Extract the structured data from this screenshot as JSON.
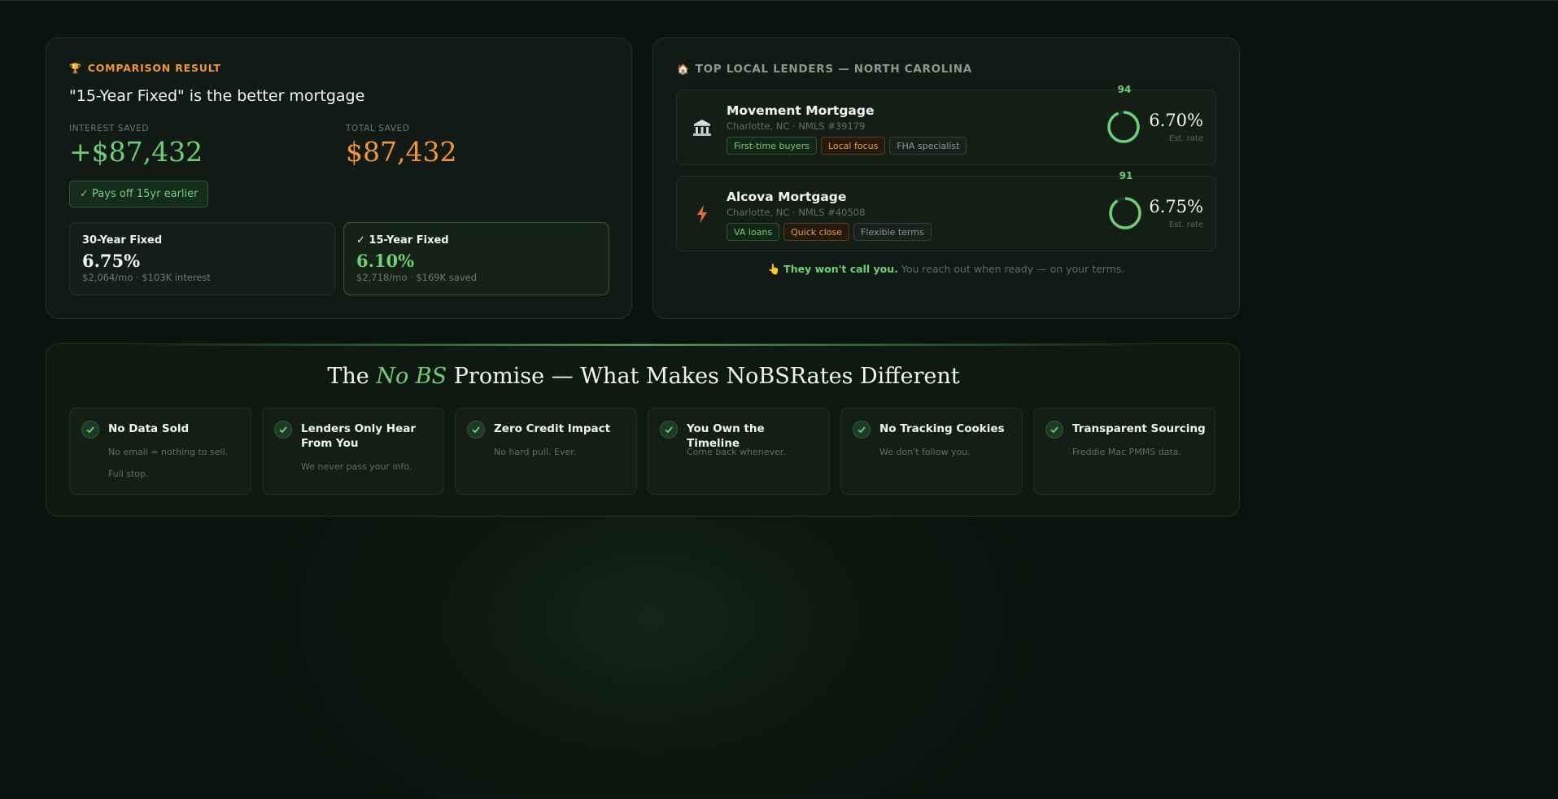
{
  "comparison": {
    "header": "COMPARISON RESULT",
    "title": "\"15-Year Fixed\" is the better mortgage",
    "interest_saved_label": "INTEREST SAVED",
    "interest_saved_value": "+$87,432",
    "total_saved_label": "TOTAL SAVED",
    "total_saved_value": "$87,432",
    "payoff_badge": "✓ Pays off 15yr earlier",
    "options": [
      {
        "name": "30-Year Fixed",
        "rate": "6.75%",
        "detail": "$2,064/mo · $103K interest"
      },
      {
        "name": "✓ 15-Year Fixed",
        "rate": "6.10%",
        "detail": "$2,718/mo · $169K saved"
      }
    ]
  },
  "lenders": {
    "header": "TOP LOCAL LENDERS — NORTH CAROLINA",
    "items": [
      {
        "name": "Movement Mortgage",
        "location": "Charlotte, NC · NMLS #39179",
        "tags": [
          "First-time buyers",
          "Local focus",
          "FHA specialist"
        ],
        "score": "94",
        "rate": "6.70%",
        "rate_label": "Est. rate",
        "icon": "bank-icon"
      },
      {
        "name": "Alcova Mortgage",
        "location": "Charlotte, NC · NMLS #40508",
        "tags": [
          "VA loans",
          "Quick close",
          "Flexible terms"
        ],
        "score": "91",
        "rate": "6.75%",
        "rate_label": "Est. rate",
        "icon": "lightning-icon"
      }
    ],
    "no_call_bold": "They won't call you.",
    "no_call_rest": " You reach out when ready — on your terms.",
    "colors": {
      "accent_green": "#6fcf76",
      "accent_orange": "#f0963a"
    }
  },
  "promise": {
    "title_pre": "The ",
    "title_em": "No BS",
    "title_post": " Promise — What Makes NoBSRates Different",
    "features": [
      {
        "title": "No Data Sold",
        "desc": "No email = nothing to sell. Full stop."
      },
      {
        "title": "Lenders Only Hear From You",
        "desc": "We never pass your info."
      },
      {
        "title": "Zero Credit Impact",
        "desc": "No hard pull. Ever."
      },
      {
        "title": "You Own the Timeline",
        "desc": "Come back whenever."
      },
      {
        "title": "No Tracking Cookies",
        "desc": "We don't follow you."
      },
      {
        "title": "Transparent Sourcing",
        "desc": "Freddie Mac PMMS data."
      }
    ]
  }
}
